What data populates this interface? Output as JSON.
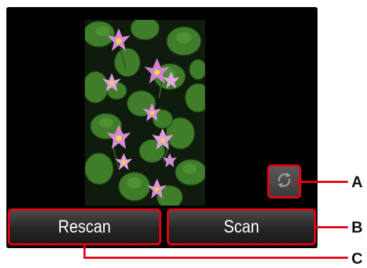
{
  "screen": {
    "preview_image": "water-lily-photo",
    "rotate_icon": "rotate-icon"
  },
  "buttons": {
    "rescan_label": "Rescan",
    "scan_label": "Scan"
  },
  "callouts": {
    "a": "A",
    "b": "B",
    "c": "C"
  },
  "colors": {
    "accent": "#e60012",
    "screen_bg": "#000000",
    "button_text": "#ffffff"
  }
}
